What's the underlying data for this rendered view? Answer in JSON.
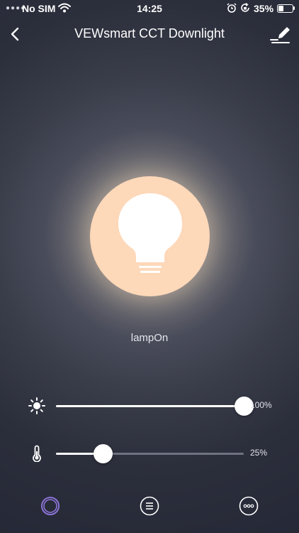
{
  "status_bar": {
    "carrier": "No SIM",
    "time": "14:25",
    "battery_percent": "35%",
    "battery_level": 0.35,
    "icons": [
      "signal-dots-icon",
      "wifi-icon",
      "alarm-icon",
      "rotation-lock-icon",
      "battery-icon"
    ]
  },
  "nav": {
    "title": "VEWsmart CCT Downlight",
    "back_icon": "back-chevron-icon",
    "edit_icon": "edit-pencil-icon"
  },
  "lamp": {
    "status": "lampOn",
    "color": "#fdd8b9",
    "icon": "lightbulb-icon"
  },
  "brightness": {
    "icon": "sun-icon",
    "value_label": "100%",
    "level": 1.0
  },
  "temperature": {
    "icon": "thermometer-icon",
    "value_label": "25%",
    "level": 0.25
  },
  "bottom_tabs": [
    {
      "name": "power-tab",
      "icon": "ring-icon",
      "active": true,
      "color": "#8b74d6"
    },
    {
      "name": "menu-tab",
      "icon": "list-icon",
      "active": false
    },
    {
      "name": "more-tab",
      "icon": "more-dots-icon",
      "active": false
    }
  ]
}
